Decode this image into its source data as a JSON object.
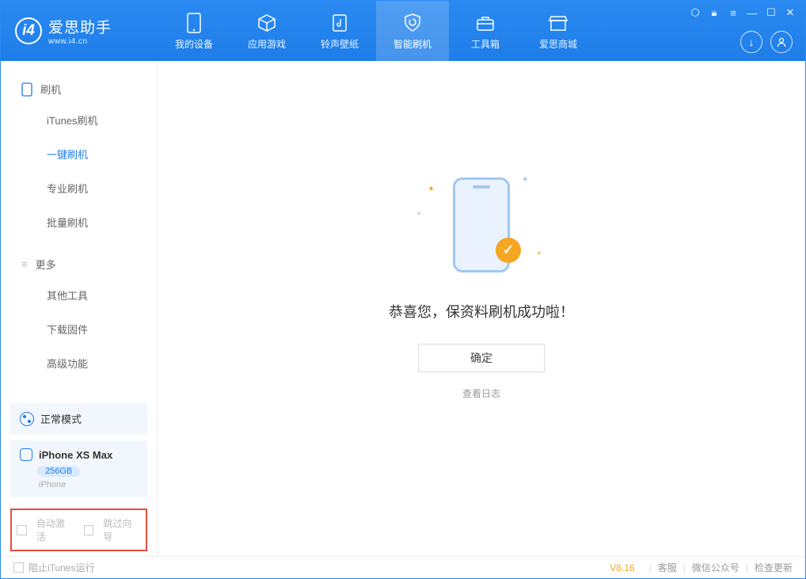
{
  "app": {
    "name": "爱思助手",
    "site": "www.i4.cn"
  },
  "nav": {
    "tabs": [
      {
        "label": "我的设备",
        "icon": "device"
      },
      {
        "label": "应用游戏",
        "icon": "cube"
      },
      {
        "label": "铃声壁纸",
        "icon": "music"
      },
      {
        "label": "智能刷机",
        "icon": "shield"
      },
      {
        "label": "工具箱",
        "icon": "toolbox"
      },
      {
        "label": "爱思商城",
        "icon": "store"
      }
    ],
    "active_index": 3
  },
  "sidebar": {
    "groups": [
      {
        "title": "刷机",
        "items": [
          "iTunes刷机",
          "一键刷机",
          "专业刷机",
          "批量刷机"
        ],
        "active_index": 1
      },
      {
        "title": "更多",
        "items": [
          "其他工具",
          "下载固件",
          "高级功能"
        ],
        "active_index": -1
      }
    ],
    "mode": "正常模式",
    "device": {
      "name": "iPhone XS Max",
      "storage": "256GB",
      "type": "iPhone"
    },
    "options": {
      "auto_activate": "自动激活",
      "skip_guide": "跳过向导"
    }
  },
  "main": {
    "success_text": "恭喜您，保资料刷机成功啦！",
    "ok_button": "确定",
    "log_link": "查看日志"
  },
  "footer": {
    "block_itunes": "阻止iTunes运行",
    "version": "V8.16",
    "links": [
      "客服",
      "微信公众号",
      "检查更新"
    ]
  }
}
